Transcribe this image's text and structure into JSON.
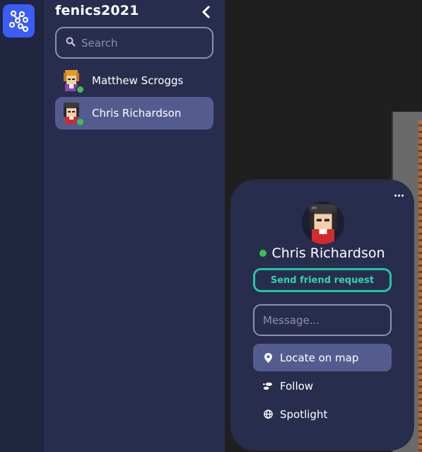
{
  "space": {
    "title": "fenics2021",
    "search_placeholder": "Search"
  },
  "members": [
    {
      "name": "Matthew Scroggs",
      "status": "online",
      "selected": false
    },
    {
      "name": "Chris Richardson",
      "status": "online",
      "selected": true
    }
  ],
  "profile_card": {
    "name": "Chris Richardson",
    "status": "online",
    "friend_button_label": "Send friend request",
    "message_placeholder": "Message...",
    "actions": [
      {
        "label": "Locate on map",
        "icon": "map-pin-icon",
        "active": true
      },
      {
        "label": "Follow",
        "icon": "footsteps-icon",
        "active": false
      },
      {
        "label": "Spotlight",
        "icon": "globe-icon",
        "active": false
      }
    ]
  },
  "colors": {
    "accent": "#3b5cf5",
    "online": "#3cbe52",
    "friend_button": "#1fc7a0",
    "panel": "#282d4e",
    "selected": "#545c8f"
  }
}
